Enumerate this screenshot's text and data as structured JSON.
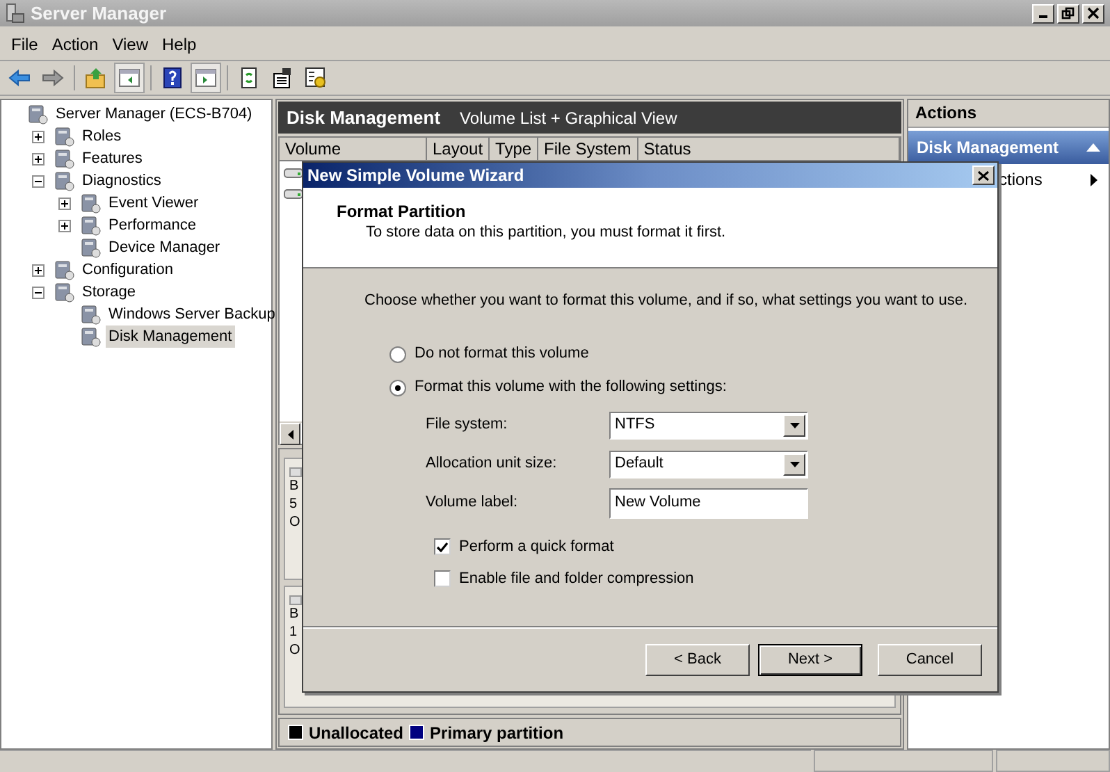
{
  "window": {
    "title": "Server Manager"
  },
  "menu": [
    "File",
    "Action",
    "View",
    "Help"
  ],
  "tree": [
    {
      "label": "Server Manager (ECS-B704)",
      "selected": false,
      "children": [
        {
          "label": "Roles",
          "expanded": false,
          "selected": false
        },
        {
          "label": "Features",
          "expanded": false,
          "selected": false
        },
        {
          "label": "Diagnostics",
          "expanded": true,
          "selected": false,
          "children": [
            {
              "label": "Event Viewer",
              "expanded": false,
              "selected": false
            },
            {
              "label": "Performance",
              "expanded": false,
              "selected": false
            },
            {
              "label": "Device Manager",
              "selected": false
            }
          ]
        },
        {
          "label": "Configuration",
          "expanded": false,
          "selected": false
        },
        {
          "label": "Storage",
          "expanded": true,
          "selected": false,
          "children": [
            {
              "label": "Windows Server Backup",
              "selected": false
            },
            {
              "label": "Disk Management",
              "selected": true
            }
          ]
        }
      ]
    }
  ],
  "center": {
    "title": "Disk Management",
    "subtitle": "Volume List + Graphical View",
    "columns": [
      "Volume",
      "Layout",
      "Type",
      "File System",
      "Status"
    ],
    "disks": [
      {
        "name": "B",
        "size": "5",
        "status": "O"
      },
      {
        "name": "B",
        "size": "1",
        "status": "O"
      }
    ],
    "legend": [
      {
        "label": "Unallocated",
        "color": "#000000"
      },
      {
        "label": "Primary partition",
        "color": "#000080"
      }
    ]
  },
  "actions": {
    "title": "Actions",
    "section": "Disk Management",
    "expanded": true,
    "items": [
      "ctions"
    ]
  },
  "dialog": {
    "title": "New Simple Volume Wizard",
    "heading": "Format Partition",
    "subheading": "To store data on this partition, you must format it first.",
    "prompt": "Choose whether you want to format this volume, and if so, what settings you want to use.",
    "options": [
      {
        "label": "Do not format this volume",
        "selected": false
      },
      {
        "label": "Format this volume with the following settings:",
        "selected": true
      }
    ],
    "fields": [
      {
        "label": "File system:",
        "kind": "select",
        "value": "NTFS"
      },
      {
        "label": "Allocation unit size:",
        "kind": "select",
        "value": "Default"
      },
      {
        "label": "Volume label:",
        "kind": "text",
        "value": "New Volume"
      }
    ],
    "checkboxes": [
      {
        "label": "Perform a quick format",
        "checked": true
      },
      {
        "label": "Enable file and folder compression",
        "checked": false
      }
    ],
    "buttons": [
      {
        "label": "< Back",
        "default": false
      },
      {
        "label": "Next >",
        "default": true
      },
      {
        "label": "Cancel",
        "default": false
      }
    ]
  }
}
